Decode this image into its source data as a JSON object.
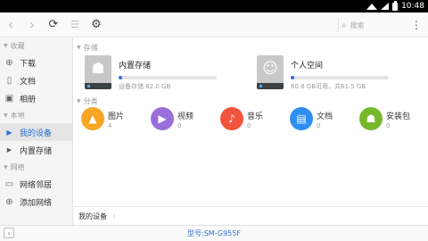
{
  "status_bar": {
    "time": "10:48"
  },
  "toolbar": {
    "back_icon": "‹",
    "forward_icon": "›",
    "refresh_icon": "⟳",
    "list_icon": "☰",
    "settings_icon": "⚙",
    "search_icon": "⌕",
    "search_placeholder": "搜索",
    "more_icon": "⋮"
  },
  "sidebar": {
    "sections": [
      {
        "label": "收藏",
        "items": [
          {
            "label": "下载",
            "icon": "download-icon"
          },
          {
            "label": "文档",
            "icon": "document-icon"
          },
          {
            "label": "相册",
            "icon": "image-icon"
          }
        ]
      },
      {
        "label": "本地",
        "items": [
          {
            "label": "我的设备",
            "icon": "chevron-right-icon",
            "active": true
          },
          {
            "label": "内置存储",
            "icon": "chevron-right-icon"
          }
        ]
      },
      {
        "label": "网络",
        "items": [
          {
            "label": "网络邻居",
            "icon": "monitor-icon"
          },
          {
            "label": "添加网络",
            "icon": "add-circle-icon"
          }
        ]
      }
    ]
  },
  "main": {
    "storage_section_label": "存储",
    "storage": [
      {
        "name": "内置存储",
        "meta": "设备存储 62.0 GB",
        "usage_fraction": 0.01,
        "icon": "android-icon"
      },
      {
        "name": "个人空间",
        "meta": "60.8 GB可用，共61.5 GB",
        "usage_fraction": 0.01,
        "icon": "person-icon"
      }
    ],
    "category_section_label": "分类",
    "categories": [
      {
        "label": "图片",
        "count": "4",
        "color": "#f5a623",
        "icon": "picture-icon"
      },
      {
        "label": "视频",
        "count": "0",
        "color": "#9b6fd9",
        "icon": "video-icon"
      },
      {
        "label": "音乐",
        "count": "0",
        "color": "#f2533d",
        "icon": "music-icon"
      },
      {
        "label": "文档",
        "count": "0",
        "color": "#2f8ff0",
        "icon": "document-icon"
      },
      {
        "label": "安装包",
        "count": "0",
        "color": "#76b82a",
        "icon": "android-icon"
      }
    ]
  },
  "breadcrumb": {
    "current": "我的设备"
  },
  "bottom_bar": {
    "collapse_icon": "‹",
    "model": "型号:SM-G955F"
  }
}
